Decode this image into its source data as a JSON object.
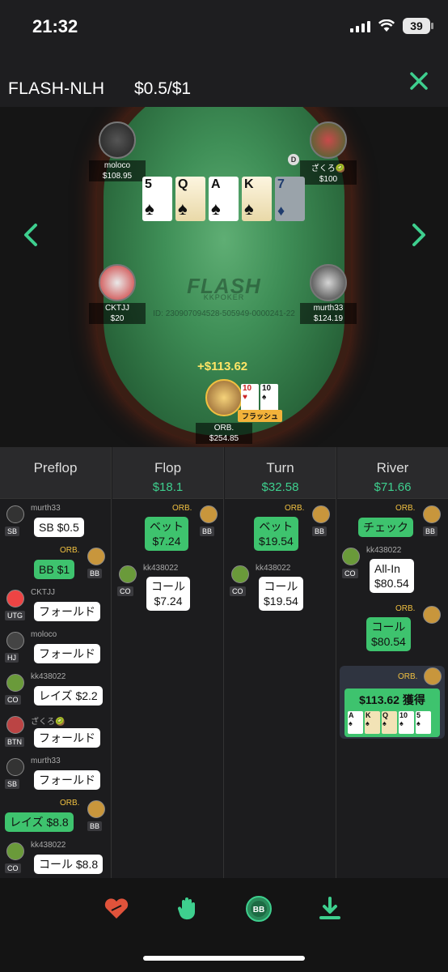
{
  "status": {
    "time": "21:32",
    "battery": "39"
  },
  "header": {
    "title": "FLASH-NLH",
    "stakes": "$0.5/$1"
  },
  "table": {
    "logo": "FLASH",
    "logo_sub": "KKPOKER",
    "hand_id": "ID: 230907094528-505949-0000241-22",
    "dealer": "D",
    "win_amount": "+$113.62",
    "hero_badge": "フラッシュ",
    "seats": {
      "top_left": {
        "name": "moloco",
        "stack": "$108.95"
      },
      "top_right": {
        "name": "ざくろ🥝",
        "stack": "$100"
      },
      "mid_left": {
        "name": "CKTJJ",
        "stack": "$20"
      },
      "mid_right": {
        "name": "murth33",
        "stack": "$124.19"
      },
      "hero": {
        "name": "ORB.",
        "stack": "$254.85"
      }
    },
    "board": [
      {
        "rank": "5",
        "suit": "♠"
      },
      {
        "rank": "Q",
        "suit": "♠"
      },
      {
        "rank": "A",
        "suit": "♠"
      },
      {
        "rank": "K",
        "suit": "♠"
      },
      {
        "rank": "7",
        "suit": "♦"
      }
    ],
    "hero_cards": [
      {
        "rank": "10",
        "suit": "♥"
      },
      {
        "rank": "10",
        "suit": "♠"
      }
    ]
  },
  "history": {
    "preflop": {
      "title": "Preflop",
      "actions": [
        {
          "name": "murth33",
          "pos": "SB",
          "action": "SB $0.5"
        },
        {
          "name": "ORB.",
          "pos": "BB",
          "action": "BB $1"
        },
        {
          "name": "CKTJJ",
          "pos": "UTG",
          "action": "フォールド"
        },
        {
          "name": "moloco",
          "pos": "HJ",
          "action": "フォールド"
        },
        {
          "name": "kk438022",
          "pos": "CO",
          "action": "レイズ $2.2"
        },
        {
          "name": "ざくろ🥝",
          "pos": "BTN",
          "action": "フォールド"
        },
        {
          "name": "murth33",
          "pos": "SB",
          "action": "フォールド"
        },
        {
          "name": "ORB.",
          "pos": "BB",
          "action": "レイズ $8.8"
        },
        {
          "name": "kk438022",
          "pos": "CO",
          "action": "コール $8.8"
        }
      ]
    },
    "flop": {
      "title": "Flop",
      "pot": "$18.1",
      "actions": [
        {
          "name": "ORB.",
          "pos": "BB",
          "action1": "ベット",
          "action2": "$7.24"
        },
        {
          "name": "kk438022",
          "pos": "CO",
          "action1": "コール",
          "action2": "$7.24"
        }
      ]
    },
    "turn": {
      "title": "Turn",
      "pot": "$32.58",
      "actions": [
        {
          "name": "ORB.",
          "pos": "BB",
          "action1": "ベット",
          "action2": "$19.54"
        },
        {
          "name": "kk438022",
          "pos": "CO",
          "action1": "コール",
          "action2": "$19.54"
        }
      ]
    },
    "river": {
      "title": "River",
      "pot": "$71.66",
      "actions": [
        {
          "name": "ORB.",
          "pos": "BB",
          "action": "チェック"
        },
        {
          "name": "kk438022",
          "pos": "CO",
          "action1": "All-In",
          "action2": "$80.54"
        },
        {
          "name": "ORB.",
          "pos": "BB",
          "action1": "コール",
          "action2": "$80.54"
        }
      ],
      "winner": {
        "name": "ORB.",
        "text": "$113.62 獲得"
      },
      "win_cards": [
        {
          "rank": "A",
          "suit": "♠"
        },
        {
          "rank": "K",
          "suit": "♠"
        },
        {
          "rank": "Q",
          "suit": "♠"
        },
        {
          "rank": "10",
          "suit": "♠"
        },
        {
          "rank": "5",
          "suit": "♠"
        }
      ]
    }
  },
  "colors": {
    "accent_green": "#3ecf8e",
    "bubble_green": "#3ec36e",
    "gold": "#f0c040"
  },
  "bottom_bar": [
    "heart-fold-icon",
    "hand-icon",
    "bb-chip-icon",
    "download-icon"
  ]
}
